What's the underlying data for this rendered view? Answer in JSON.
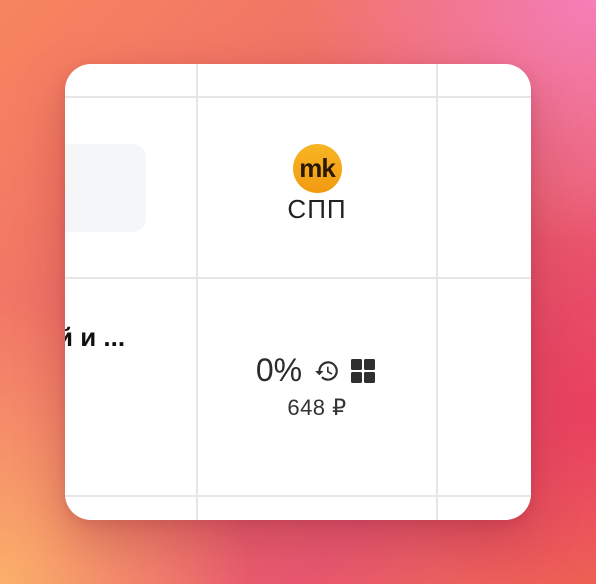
{
  "left_column": {
    "title_fragment": "й и ..."
  },
  "brand": {
    "logo_text": "mk",
    "name": "СПП"
  },
  "stats": {
    "percent": "0%",
    "price": "648 ₽",
    "history_icon": "history-icon",
    "grid_icon": "grid-icon"
  }
}
